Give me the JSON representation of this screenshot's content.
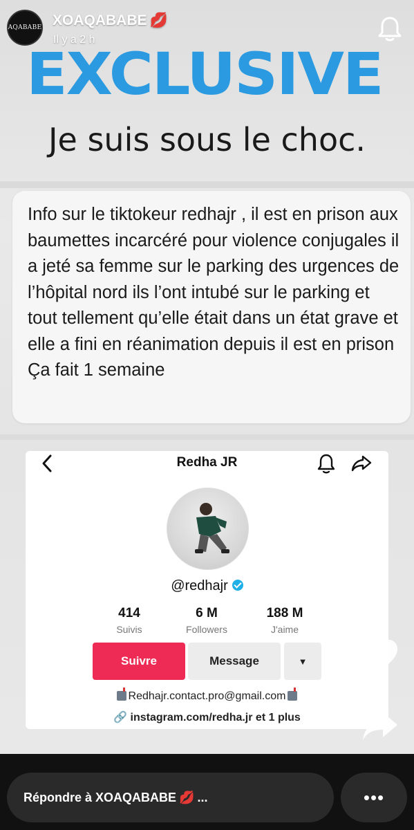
{
  "header": {
    "avatar_text": "AQABABE",
    "username": "XOAQABABE",
    "username_emoji": "💋",
    "time": "Il y a 2 h"
  },
  "story": {
    "headline": "EXCLUSIVE",
    "subtitle": "Je suis sous le choc.",
    "message": "Info sur le tiktokeur redhajr , il est en prison aux baumettes incarcéré pour violence conjugales il a jeté sa femme sur le parking des urgences de l’hôpital nord ils l’ont intubé sur le parking et tout tellement qu’elle était dans un état grave et elle a fini en réanimation depuis il est en prison Ça fait 1 semaine"
  },
  "profile": {
    "title": "Redha JR",
    "handle": "@redhajr",
    "stats": [
      {
        "value": "414",
        "label": "Suivis"
      },
      {
        "value": "6 M",
        "label": "Followers"
      },
      {
        "value": "188 M",
        "label": "J'aime"
      }
    ],
    "follow_label": "Suivre",
    "message_label": "Message",
    "more_label": "▼",
    "email": "Redhajr.contact.pro@gmail.com",
    "link": "instagram.com/redha.jr et 1 plus"
  },
  "footer": {
    "reply_text": "Répondre à XOAQABABE",
    "reply_emoji": "💋",
    "reply_ellipsis": "...",
    "more_label": "•••"
  },
  "colors": {
    "headline": "#2b9ae0",
    "follow": "#ee2b55",
    "verified": "#20b0e8"
  }
}
